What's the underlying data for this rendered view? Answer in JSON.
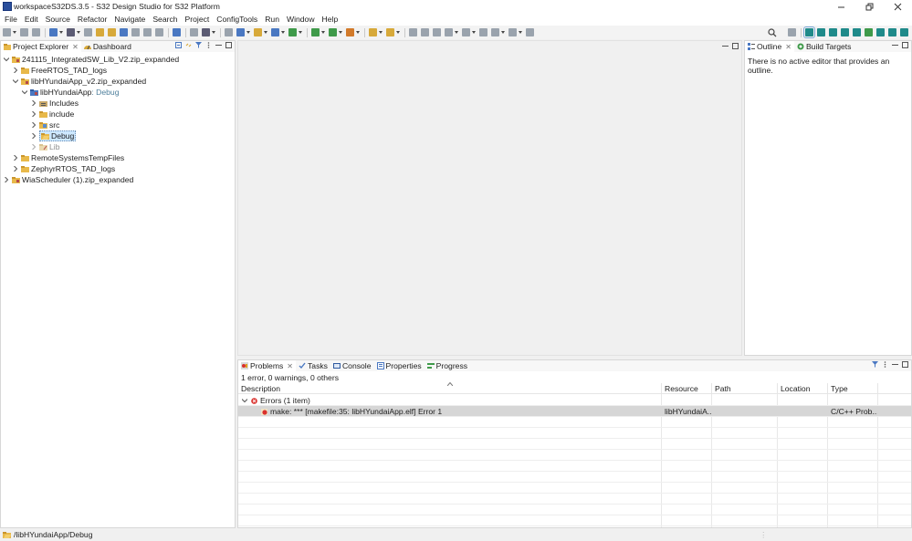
{
  "window": {
    "title": "workspaceS32DS.3.5 - S32 Design Studio for S32 Platform"
  },
  "menu": [
    "File",
    "Edit",
    "Source",
    "Refactor",
    "Navigate",
    "Search",
    "Project",
    "ConfigTools",
    "Run",
    "Window",
    "Help"
  ],
  "left_panel": {
    "tabs": [
      {
        "label": "Project Explorer",
        "icon": "project-explorer-icon"
      },
      {
        "label": "Dashboard",
        "icon": "dashboard-icon"
      }
    ],
    "tree": [
      {
        "label": "241115_IntegratedSW_Lib_V2.zip_expanded",
        "level": 0,
        "expanded": true,
        "icon": "project-folder-icon"
      },
      {
        "label": "FreeRTOS_TAD_logs",
        "level": 1,
        "expanded": false,
        "icon": "folder-icon"
      },
      {
        "label": "libHYundaiApp_v2.zip_expanded",
        "level": 1,
        "expanded": true,
        "icon": "project-folder-icon"
      },
      {
        "label": "libHYundaiApp",
        "decoration": ": Debug",
        "level": 2,
        "expanded": true,
        "icon": "c-project-icon"
      },
      {
        "label": "Includes",
        "level": 3,
        "expanded": false,
        "icon": "includes-icon"
      },
      {
        "label": "include",
        "level": 3,
        "expanded": false,
        "icon": "folder-icon"
      },
      {
        "label": "src",
        "level": 3,
        "expanded": false,
        "icon": "source-folder-icon"
      },
      {
        "label": "Debug",
        "level": 3,
        "expanded": false,
        "icon": "folder-icon",
        "selected": true
      },
      {
        "label": "Lib",
        "level": 3,
        "expanded": false,
        "icon": "excluded-folder-icon",
        "muted": true
      },
      {
        "label": "RemoteSystemsTempFiles",
        "level": 1,
        "expanded": false,
        "icon": "folder-icon"
      },
      {
        "label": "ZephyrRTOS_TAD_logs",
        "level": 1,
        "expanded": false,
        "icon": "folder-icon"
      },
      {
        "label": "WiaScheduler (1).zip_expanded",
        "level": 0,
        "expanded": false,
        "icon": "project-folder-icon"
      }
    ]
  },
  "right_panel": {
    "tabs": [
      {
        "label": "Outline",
        "icon": "outline-icon"
      },
      {
        "label": "Build Targets",
        "icon": "build-targets-icon"
      }
    ],
    "message": "There is no active editor that provides an outline."
  },
  "bottom_panel": {
    "tabs": [
      {
        "label": "Problems",
        "icon": "problems-icon"
      },
      {
        "label": "Tasks",
        "icon": "tasks-icon"
      },
      {
        "label": "Console",
        "icon": "console-icon"
      },
      {
        "label": "Properties",
        "icon": "properties-icon"
      },
      {
        "label": "Progress",
        "icon": "progress-icon"
      }
    ],
    "summary": "1 error, 0 warnings, 0 others",
    "columns": [
      "Description",
      "Resource",
      "Path",
      "Location",
      "Type"
    ],
    "group": "Errors (1 item)",
    "rows": [
      {
        "description": "make: *** [makefile:35: libHYundaiApp.elf] Error 1",
        "resource": "libHYundaiA...",
        "path": "",
        "location": "",
        "type": "C/C++ Prob..."
      }
    ]
  },
  "status": {
    "path": "/libHYundaiApp/Debug"
  },
  "colors": {
    "selection": "#cde8ff",
    "error": "#d9302c",
    "folder": "#e8b94a",
    "decoration": "#4e7f9c"
  }
}
